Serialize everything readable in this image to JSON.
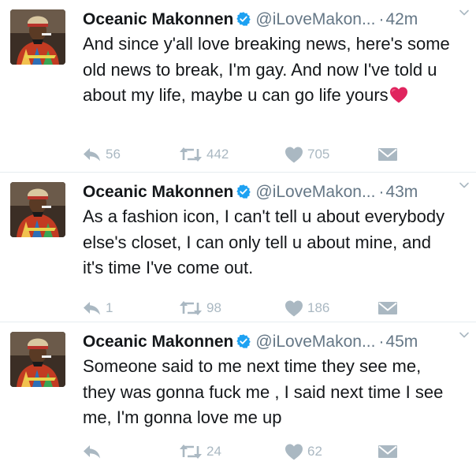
{
  "colors": {
    "verified": "#1da1f2",
    "muted": "#657786",
    "action": "#aab8c2",
    "divider": "#e6ecf0",
    "heart": "#e0245e"
  },
  "icons": [
    "verified-badge-icon",
    "caret-down-icon",
    "reply-icon",
    "retweet-icon",
    "like-icon",
    "direct-message-icon",
    "red-heart-emoji-icon"
  ],
  "tweets": [
    {
      "name": "Oceanic Makonnen",
      "handle": "@iLoveMakon...",
      "dot": "·",
      "time": "42m",
      "text": "And since y'all love breaking news, here's some old news to break, I'm gay. And now I've told u about my life, maybe u can go life yours",
      "replies": "56",
      "retweets": "442",
      "likes": "705"
    },
    {
      "name": "Oceanic Makonnen",
      "handle": "@iLoveMakon...",
      "dot": "·",
      "time": "43m",
      "text": "As a fashion icon, I can't tell u about everybody else's closet, I can only tell u about mine, and it's time I've come out.",
      "replies": "1",
      "retweets": "98",
      "likes": "186"
    },
    {
      "name": "Oceanic Makonnen",
      "handle": "@iLoveMakon...",
      "dot": "·",
      "time": "45m",
      "text": "Someone said to me next time they see me, they was gonna fuck me , I said next time I see me, I'm gonna love me up",
      "replies": "",
      "retweets": "24",
      "likes": "62"
    }
  ]
}
